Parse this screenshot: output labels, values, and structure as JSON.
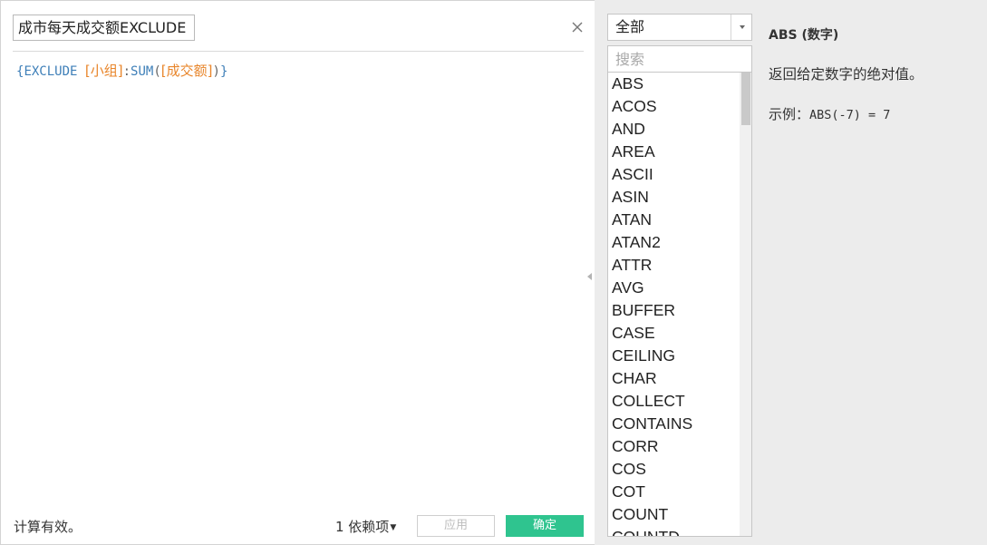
{
  "calc": {
    "name": "成市每天成交额EXCLUDE",
    "formula": {
      "open_brace": "{",
      "keyword": "EXCLUDE",
      "field1": "[小组]",
      "colon": ":",
      "fn": "SUM",
      "paren_open": "(",
      "field2": "[成交额]",
      "paren_close": ")",
      "close_brace": "}"
    },
    "status": "计算有效。",
    "dependencies": "1 依赖项",
    "apply_label": "应用",
    "ok_label": "确定"
  },
  "functions": {
    "category": "全部",
    "search_placeholder": "搜索",
    "items": [
      "ABS",
      "ACOS",
      "AND",
      "AREA",
      "ASCII",
      "ASIN",
      "ATAN",
      "ATAN2",
      "ATTR",
      "AVG",
      "BUFFER",
      "CASE",
      "CEILING",
      "CHAR",
      "COLLECT",
      "CONTAINS",
      "CORR",
      "COS",
      "COT",
      "COUNT",
      "COUNTD"
    ]
  },
  "doc": {
    "title": "ABS (数字)",
    "description": "返回给定数字的绝对值。",
    "example_label": "示例：",
    "example_code": "ABS(-7) = 7"
  },
  "colors": {
    "accent_green": "#2fc48f",
    "formula_blue": "#3e7fb8",
    "formula_orange": "#e8852a",
    "panel_gray": "#ececec"
  }
}
